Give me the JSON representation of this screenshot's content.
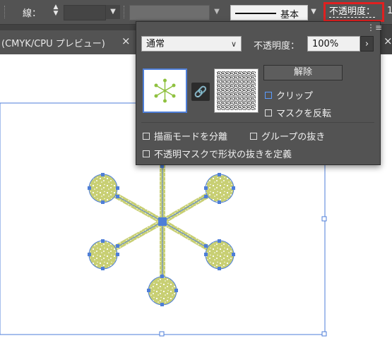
{
  "control_bar": {
    "stroke_label": "線：",
    "stroke_style": "基本",
    "opacity_label": "不透明度：",
    "right_partial": "1"
  },
  "doc_tab": {
    "title": "(CMYK/CPU プレビュー)",
    "close": "×"
  },
  "tab_bar": {
    "right_close": "×"
  },
  "transparency_panel": {
    "menu_icon": "panel-menu-icon",
    "blend_mode": "通常",
    "opacity_label": "不透明度：",
    "opacity_value": "100%",
    "opacity_arrow": "›",
    "release_button": "解除",
    "clip_label": "クリップ",
    "invert_mask_label": "マスクを反転",
    "isolate_blending_label": "描画モードを分離",
    "knockout_group_label": "グループの抜き",
    "opacity_mask_knockout_label": "不透明マスクで形状の抜きを定義"
  },
  "colors": {
    "panel_bg": "#535353",
    "highlight": "#e02020",
    "selection": "#4e7ed8",
    "artwork_fill": "#c8cf73"
  }
}
